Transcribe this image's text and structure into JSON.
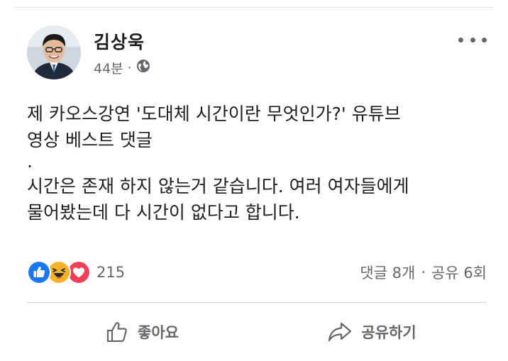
{
  "post": {
    "author": "김상욱",
    "time": "44분",
    "separator": "·",
    "privacy_icon": "globe-icon",
    "more_icon": "more-horizontal-icon",
    "lines": [
      "제 카오스강연 '도대체 시간이란 무엇인가?' 유튜브",
      "영상 베스트 댓글",
      ".",
      "시간은 존재 하지 않는거 같습니다. 여러 여자들에게",
      "물어봤는데 다 시간이 없다고 합니다."
    ]
  },
  "reactions": {
    "icons": [
      "like-icon",
      "haha-icon",
      "love-icon"
    ],
    "colors": {
      "like": "#1877f2",
      "haha": "#f7b125",
      "love": "#f33e58"
    },
    "count": "215"
  },
  "counts": {
    "comments": "댓글 8개",
    "separator": "·",
    "shares": "공유 6회"
  },
  "actions": {
    "like_label": "좋아요",
    "share_label": "공유하기"
  }
}
